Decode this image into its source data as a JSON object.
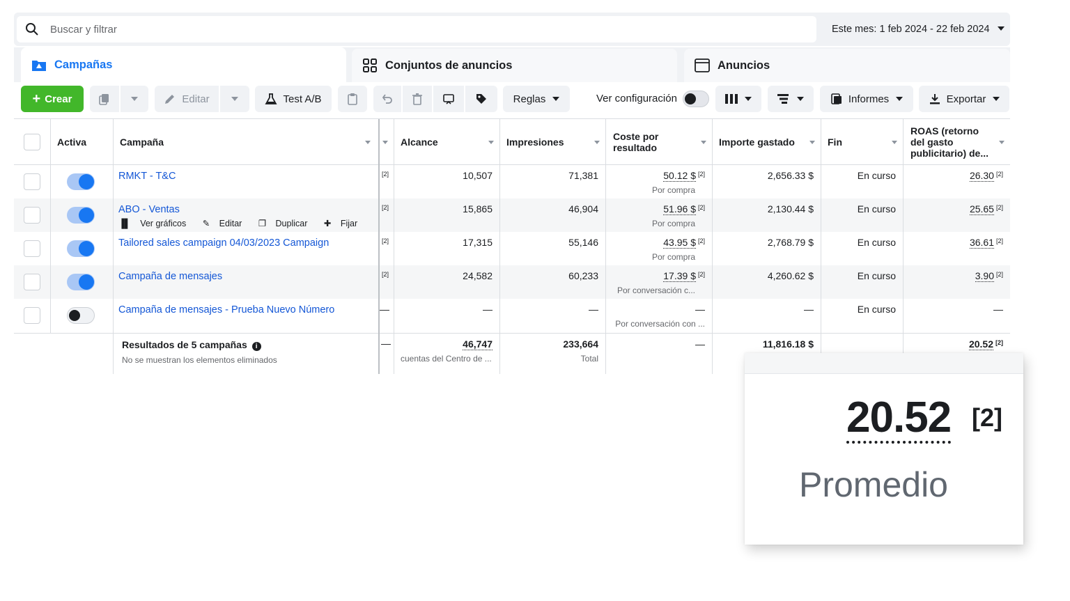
{
  "search": {
    "placeholder": "Buscar y filtrar"
  },
  "date_range": {
    "label": "Este mes: 1 feb 2024 - 22 feb 2024"
  },
  "tabs": [
    {
      "label": "Campañas"
    },
    {
      "label": "Conjuntos de anuncios"
    },
    {
      "label": "Anuncios"
    }
  ],
  "toolbar": {
    "create_label": "Crear",
    "edit_label": "Editar",
    "ab_test_label": "Test A/B",
    "rules_label": "Reglas",
    "view_settings_label": "Ver configuración",
    "reports_label": "Informes",
    "export_label": "Exportar"
  },
  "columns": {
    "active": "Activa",
    "campaign": "Campaña",
    "reach": "Alcance",
    "impressions": "Impresiones",
    "cost_per_result": "Coste por resultado",
    "amount_spent": "Importe gastado",
    "end": "Fin",
    "roas": "ROAS (retorno del gasto publicitario) de..."
  },
  "ref_marker": "[2]",
  "rows": [
    {
      "name": "RMKT - T&C",
      "active": true,
      "reach": "10,507",
      "impressions": "71,381",
      "cost": "50.12 $",
      "cost_type": "Por compra",
      "spent": "2,656.33 $",
      "end": "En curso",
      "roas": "26.30"
    },
    {
      "name": "ABO - Ventas",
      "active": true,
      "reach": "15,865",
      "impressions": "46,904",
      "cost": "51.96 $",
      "cost_type": "Por compra",
      "spent": "2,130.44 $",
      "end": "En curso",
      "roas": "25.65"
    },
    {
      "name": "Tailored sales campaign 04/03/2023 Campaign",
      "active": true,
      "reach": "17,315",
      "impressions": "55,146",
      "cost": "43.95 $",
      "cost_type": "Por compra",
      "spent": "2,768.79 $",
      "end": "En curso",
      "roas": "36.61"
    },
    {
      "name": "Campaña de mensajes",
      "active": true,
      "reach": "24,582",
      "impressions": "60,233",
      "cost": "17.39 $",
      "cost_type": "Por conversación c...",
      "spent": "4,260.62 $",
      "end": "En curso",
      "roas": "3.90"
    },
    {
      "name": "Campaña de mensajes - Prueba Nuevo Número",
      "active": false,
      "reach": "—",
      "impressions": "—",
      "cost": "—",
      "cost_type": "Por conversación con ...",
      "spent": "—",
      "end": "En curso",
      "roas": "—"
    }
  ],
  "row_actions": {
    "charts": "Ver gráficos",
    "edit": "Editar",
    "duplicate": "Duplicar",
    "pin": "Fijar"
  },
  "totals": {
    "title": "Resultados de 5 campañas",
    "note": "No se muestran los elementos eliminados",
    "reach": "46,747",
    "reach_note": "cuentas del Centro de ...",
    "impressions": "233,664",
    "impressions_note": "Total",
    "cost": "—",
    "spent": "11,816.18 $",
    "roas": "20.52"
  },
  "zoom_callout": {
    "value": "20.52",
    "ref": "[2]",
    "label": "Promedio"
  },
  "colors": {
    "accent": "#1877f2",
    "create": "#42b72a",
    "link": "#1457d6"
  }
}
